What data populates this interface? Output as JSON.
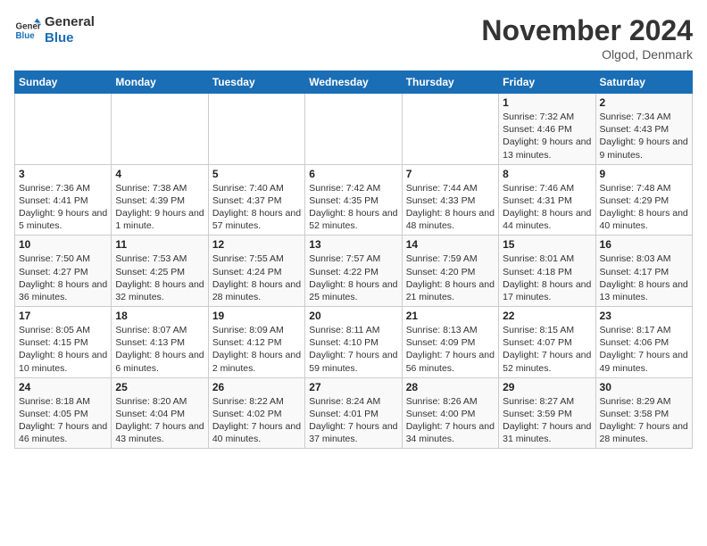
{
  "logo": {
    "line1": "General",
    "line2": "Blue"
  },
  "title": "November 2024",
  "location": "Olgod, Denmark",
  "weekdays": [
    "Sunday",
    "Monday",
    "Tuesday",
    "Wednesday",
    "Thursday",
    "Friday",
    "Saturday"
  ],
  "weeks": [
    [
      {
        "day": "",
        "info": ""
      },
      {
        "day": "",
        "info": ""
      },
      {
        "day": "",
        "info": ""
      },
      {
        "day": "",
        "info": ""
      },
      {
        "day": "",
        "info": ""
      },
      {
        "day": "1",
        "info": "Sunrise: 7:32 AM\nSunset: 4:46 PM\nDaylight: 9 hours and 13 minutes."
      },
      {
        "day": "2",
        "info": "Sunrise: 7:34 AM\nSunset: 4:43 PM\nDaylight: 9 hours and 9 minutes."
      }
    ],
    [
      {
        "day": "3",
        "info": "Sunrise: 7:36 AM\nSunset: 4:41 PM\nDaylight: 9 hours and 5 minutes."
      },
      {
        "day": "4",
        "info": "Sunrise: 7:38 AM\nSunset: 4:39 PM\nDaylight: 9 hours and 1 minute."
      },
      {
        "day": "5",
        "info": "Sunrise: 7:40 AM\nSunset: 4:37 PM\nDaylight: 8 hours and 57 minutes."
      },
      {
        "day": "6",
        "info": "Sunrise: 7:42 AM\nSunset: 4:35 PM\nDaylight: 8 hours and 52 minutes."
      },
      {
        "day": "7",
        "info": "Sunrise: 7:44 AM\nSunset: 4:33 PM\nDaylight: 8 hours and 48 minutes."
      },
      {
        "day": "8",
        "info": "Sunrise: 7:46 AM\nSunset: 4:31 PM\nDaylight: 8 hours and 44 minutes."
      },
      {
        "day": "9",
        "info": "Sunrise: 7:48 AM\nSunset: 4:29 PM\nDaylight: 8 hours and 40 minutes."
      }
    ],
    [
      {
        "day": "10",
        "info": "Sunrise: 7:50 AM\nSunset: 4:27 PM\nDaylight: 8 hours and 36 minutes."
      },
      {
        "day": "11",
        "info": "Sunrise: 7:53 AM\nSunset: 4:25 PM\nDaylight: 8 hours and 32 minutes."
      },
      {
        "day": "12",
        "info": "Sunrise: 7:55 AM\nSunset: 4:24 PM\nDaylight: 8 hours and 28 minutes."
      },
      {
        "day": "13",
        "info": "Sunrise: 7:57 AM\nSunset: 4:22 PM\nDaylight: 8 hours and 25 minutes."
      },
      {
        "day": "14",
        "info": "Sunrise: 7:59 AM\nSunset: 4:20 PM\nDaylight: 8 hours and 21 minutes."
      },
      {
        "day": "15",
        "info": "Sunrise: 8:01 AM\nSunset: 4:18 PM\nDaylight: 8 hours and 17 minutes."
      },
      {
        "day": "16",
        "info": "Sunrise: 8:03 AM\nSunset: 4:17 PM\nDaylight: 8 hours and 13 minutes."
      }
    ],
    [
      {
        "day": "17",
        "info": "Sunrise: 8:05 AM\nSunset: 4:15 PM\nDaylight: 8 hours and 10 minutes."
      },
      {
        "day": "18",
        "info": "Sunrise: 8:07 AM\nSunset: 4:13 PM\nDaylight: 8 hours and 6 minutes."
      },
      {
        "day": "19",
        "info": "Sunrise: 8:09 AM\nSunset: 4:12 PM\nDaylight: 8 hours and 2 minutes."
      },
      {
        "day": "20",
        "info": "Sunrise: 8:11 AM\nSunset: 4:10 PM\nDaylight: 7 hours and 59 minutes."
      },
      {
        "day": "21",
        "info": "Sunrise: 8:13 AM\nSunset: 4:09 PM\nDaylight: 7 hours and 56 minutes."
      },
      {
        "day": "22",
        "info": "Sunrise: 8:15 AM\nSunset: 4:07 PM\nDaylight: 7 hours and 52 minutes."
      },
      {
        "day": "23",
        "info": "Sunrise: 8:17 AM\nSunset: 4:06 PM\nDaylight: 7 hours and 49 minutes."
      }
    ],
    [
      {
        "day": "24",
        "info": "Sunrise: 8:18 AM\nSunset: 4:05 PM\nDaylight: 7 hours and 46 minutes."
      },
      {
        "day": "25",
        "info": "Sunrise: 8:20 AM\nSunset: 4:04 PM\nDaylight: 7 hours and 43 minutes."
      },
      {
        "day": "26",
        "info": "Sunrise: 8:22 AM\nSunset: 4:02 PM\nDaylight: 7 hours and 40 minutes."
      },
      {
        "day": "27",
        "info": "Sunrise: 8:24 AM\nSunset: 4:01 PM\nDaylight: 7 hours and 37 minutes."
      },
      {
        "day": "28",
        "info": "Sunrise: 8:26 AM\nSunset: 4:00 PM\nDaylight: 7 hours and 34 minutes."
      },
      {
        "day": "29",
        "info": "Sunrise: 8:27 AM\nSunset: 3:59 PM\nDaylight: 7 hours and 31 minutes."
      },
      {
        "day": "30",
        "info": "Sunrise: 8:29 AM\nSunset: 3:58 PM\nDaylight: 7 hours and 28 minutes."
      }
    ]
  ]
}
